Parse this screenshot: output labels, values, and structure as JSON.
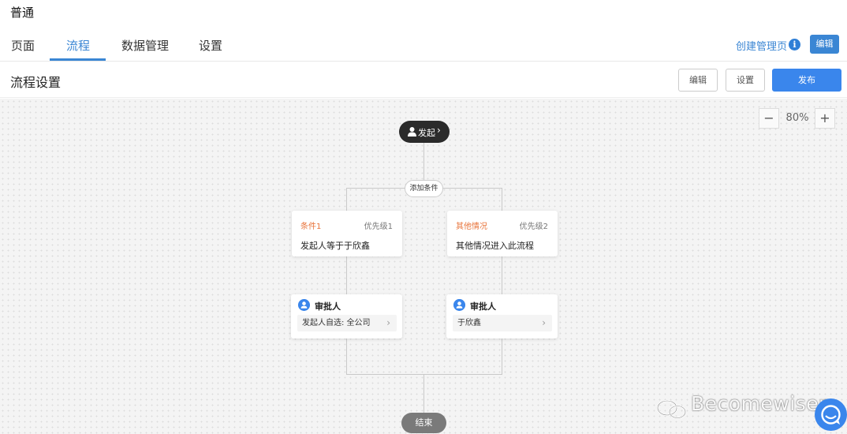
{
  "app": {
    "title": "普通"
  },
  "tabs": [
    {
      "label": "页面",
      "active": false
    },
    {
      "label": "流程",
      "active": true
    },
    {
      "label": "数据管理",
      "active": false
    },
    {
      "label": "设置",
      "active": false
    }
  ],
  "header_right": {
    "create_link": "创建管理页",
    "info_icon": "info-icon",
    "edit_label": "编辑"
  },
  "subheader": {
    "title": "流程设置",
    "edit_label": "编辑",
    "settings_label": "设置",
    "publish_label": "发布"
  },
  "zoom": {
    "minus": "−",
    "value": "80%",
    "plus": "+"
  },
  "flow": {
    "start": {
      "label": "发起",
      "chevron": "›"
    },
    "add_condition": "添加条件",
    "conditions": [
      {
        "name": "条件1",
        "priority": "优先级1",
        "description": "发起人等于于欣鑫"
      },
      {
        "name": "其他情况",
        "priority": "优先级2",
        "description": "其他情况进入此流程"
      }
    ],
    "approvers": [
      {
        "title": "审批人",
        "value": "发起人自选: 全公司",
        "arrow": "›"
      },
      {
        "title": "审批人",
        "value": "于欣鑫",
        "arrow": "›"
      }
    ],
    "end": {
      "label": "结束"
    }
  },
  "watermark": {
    "text": "Becomewiser"
  },
  "colors": {
    "accent": "#3a86d4",
    "primary_button": "#3a86ec",
    "condition_orange": "#e8743b",
    "start_node": "#2b2b2b",
    "end_node": "#7a7a7a"
  }
}
